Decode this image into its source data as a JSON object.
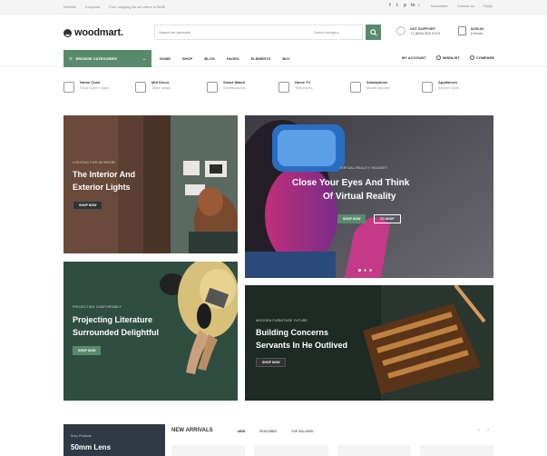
{
  "topbar": {
    "left_links": [
      "Wishlist",
      "Compare",
      "Free shipping for all orders of $150"
    ],
    "social_icons": [
      "facebook-icon",
      "twitter-icon",
      "pinterest-icon",
      "linkedin-icon",
      "telegram-icon"
    ],
    "right_links": [
      "Newsletter",
      "Contact us",
      "FAQs"
    ]
  },
  "header": {
    "logo_text": "woodmart.",
    "search_placeholder": "Search for products",
    "search_category": "Select category",
    "support_label": "24/7 SUPPORT",
    "support_phone": "+1 (800) 555 0123",
    "cart_label": "$199.00",
    "cart_count": "0 items"
  },
  "nav": {
    "browse_label": "BROWSE CATEGORIES",
    "items": [
      "HOME",
      "SHOP",
      "BLOG",
      "PAGES",
      "ELEMENTS",
      "BUY"
    ],
    "account": "MY ACCOUNT",
    "wishlist": "WISHLIST",
    "compare": "COMPARE"
  },
  "categories": [
    {
      "title": "Home Chair",
      "sub": "Shop home chairs",
      "icon": "chair-icon"
    },
    {
      "title": "Mid Decor",
      "sub": "Table lamps",
      "icon": "lamp-icon"
    },
    {
      "title": "Smart Watch",
      "sub": "Smartwatches",
      "icon": "watch-icon"
    },
    {
      "title": "Home TV",
      "sub": "Televisions",
      "icon": "tv-icon"
    },
    {
      "title": "Smartphone",
      "sub": "Mobile phones",
      "icon": "phone-icon"
    },
    {
      "title": "Appliances",
      "sub": "Kitchen tools",
      "icon": "appliance-icon"
    }
  ],
  "banners": {
    "interior": {
      "sub": "Lighting for interior",
      "title_1": "The Interior And",
      "title_2": "Exterior Lights",
      "button": "SHOP NOW"
    },
    "vr": {
      "sub": "Virtual reality headset",
      "title_1": "Close Your Eyes And Think",
      "title_2": "Of Virtual Reality",
      "button_1": "SHOP NOW",
      "button_2": "TO SHOP"
    },
    "literature": {
      "sub": "Projecting comfortably",
      "title_1": "Projecting Literature",
      "title_2": "Surrounded Delightful",
      "button": "SHOP NOW"
    },
    "concerns": {
      "sub": "Wooden furniture future",
      "title_1": "Building Concerns",
      "title_2": "Servants In He Outlived",
      "button": "SHOP NOW"
    }
  },
  "bottom": {
    "promo_sub": "Sony Products",
    "promo_title": "50mm Lens",
    "section_title": "NEW ARRIVALS",
    "tabs": [
      "NEW",
      "FEATURED",
      "TOP SELLERS"
    ],
    "prev": "‹",
    "next": "›"
  },
  "colors": {
    "accent": "#5a8a6e",
    "dark": "#333333"
  }
}
